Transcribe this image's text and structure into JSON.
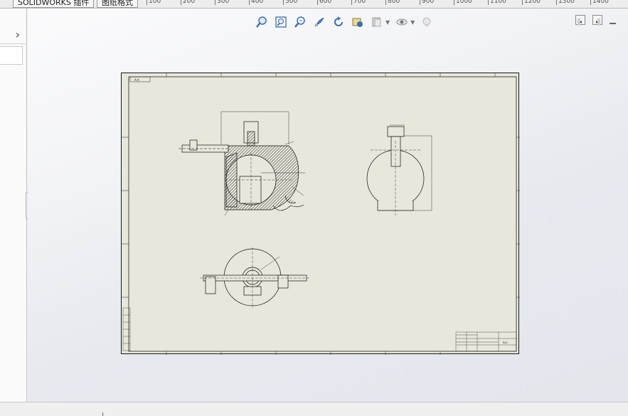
{
  "tabs": [
    {
      "label": "SOLIDWORKS 插件"
    },
    {
      "label": "图纸格式"
    }
  ],
  "ruler_labels": [
    "100",
    "200",
    "300",
    "400",
    "500",
    "600",
    "700",
    "800",
    "900",
    "1000",
    "1100",
    "1200",
    "1300",
    "1400"
  ],
  "toolbar": {
    "icons": [
      "zoom-to-fit-icon",
      "zoom-to-area-icon",
      "zoom-in-out-icon",
      "pan-icon",
      "rotate-icon",
      "view-settings-icon",
      "display-style-icon",
      "hide-show-icon",
      "appearance-icon"
    ]
  },
  "left_panel": {
    "expand_symbol": "›"
  },
  "drawing": {
    "section_label": "A-A",
    "title_block_label": "RAC"
  }
}
